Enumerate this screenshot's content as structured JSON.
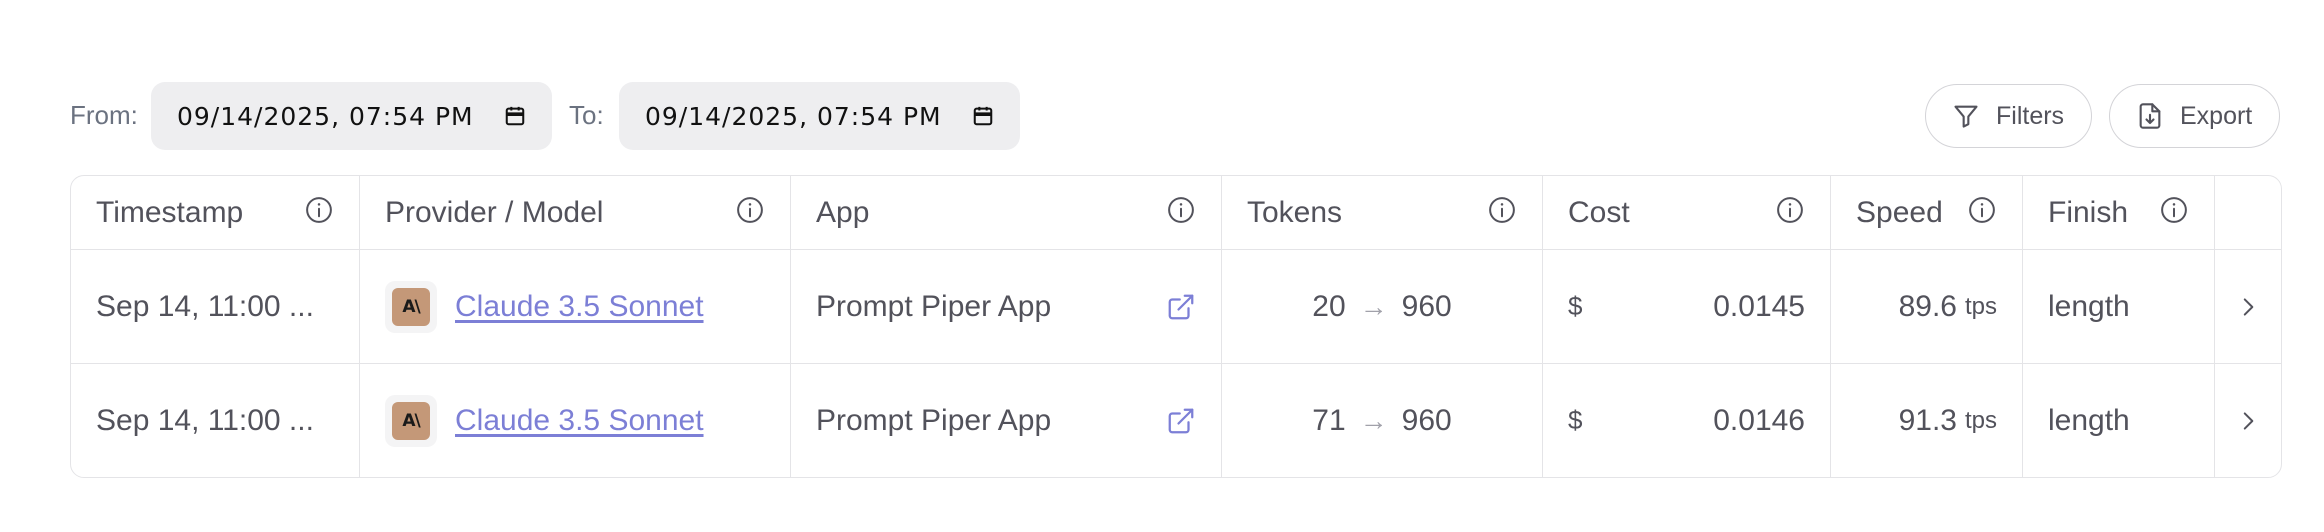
{
  "toolbar": {
    "from_label": "From:",
    "from_value": "09/14/2025, 07:54 PM",
    "to_label": "To:",
    "to_value": "09/14/2025, 07:54 PM",
    "filters_label": "Filters",
    "export_label": "Export"
  },
  "table": {
    "headers": {
      "timestamp": "Timestamp",
      "provider_model": "Provider / Model",
      "app": "App",
      "tokens": "Tokens",
      "cost": "Cost",
      "speed": "Speed",
      "finish": "Finish"
    },
    "rows": [
      {
        "timestamp": "Sep 14, 11:00 ...",
        "provider_logo": "A\\",
        "model": "Claude 3.5 Sonnet",
        "app": "Prompt Piper App",
        "tokens_in": "20",
        "tokens_arrow": "→",
        "tokens_out": "960",
        "cost_symbol": "$",
        "cost": "0.0145",
        "speed": "89.6",
        "speed_unit": "tps",
        "finish": "length"
      },
      {
        "timestamp": "Sep 14, 11:00 ...",
        "provider_logo": "A\\",
        "model": "Claude 3.5 Sonnet",
        "app": "Prompt Piper App",
        "tokens_in": "71",
        "tokens_arrow": "→",
        "tokens_out": "960",
        "cost_symbol": "$",
        "cost": "0.0146",
        "speed": "91.3",
        "speed_unit": "tps",
        "finish": "length"
      }
    ]
  },
  "colors": {
    "link": "#7c7fd6",
    "provider_logo_bg": "#c49878",
    "input_bg": "#eeeef0",
    "border": "#e4e4e7"
  },
  "icons": {
    "calendar": "calendar-icon",
    "filter": "filter-icon",
    "export": "file-download-icon",
    "info": "info-icon",
    "external": "external-link-icon",
    "chevron": "chevron-right-icon"
  }
}
